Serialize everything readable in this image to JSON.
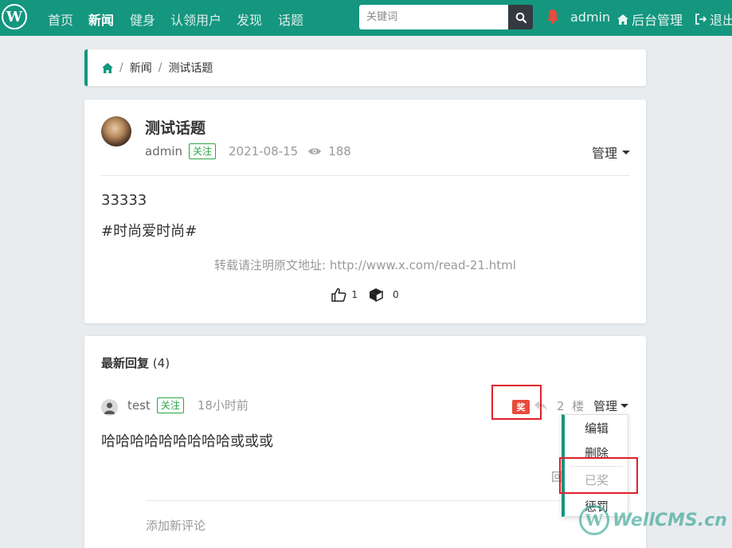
{
  "navbar": {
    "logo_letter": "W",
    "links": [
      "首页",
      "新闻",
      "健身",
      "认领用户",
      "发现",
      "话题"
    ],
    "active": "新闻",
    "search_placeholder": "关键词",
    "user": "admin",
    "admin_label": "后台管理",
    "logout_label": "退出"
  },
  "breadcrumb": {
    "items": [
      "新闻",
      "测试话题"
    ]
  },
  "post": {
    "title": "测试话题",
    "author": "admin",
    "follow_label": "关注",
    "date": "2021-08-15",
    "views": "188",
    "manage_label": "管理",
    "content_lines": [
      "33333",
      "#时尚爱时尚#"
    ],
    "copyright": "转载请注明原文地址: http://www.x.com/read-21.html",
    "likes": "1",
    "favorites": "0"
  },
  "replies": {
    "heading": "最新回复",
    "count": "(4)",
    "reply": {
      "author": "test",
      "follow_label": "关注",
      "time": "18小时前",
      "award_badge": "奖",
      "floor_number": "2",
      "floor_unit": "楼",
      "manage_label": "管理",
      "content": "哈哈哈哈哈哈哈哈哈或或或",
      "cut_text": "回"
    },
    "add_comment": "添加新评论"
  },
  "dropdown": {
    "items": [
      "编辑",
      "删除",
      "已奖",
      "惩罚"
    ]
  },
  "watermark": {
    "letter": "W",
    "text": "WellCMS.cn"
  },
  "colors": {
    "brand": "#14967f",
    "highlight": "#e0202a",
    "follow": "#28a745",
    "award": "#e74c3c"
  }
}
